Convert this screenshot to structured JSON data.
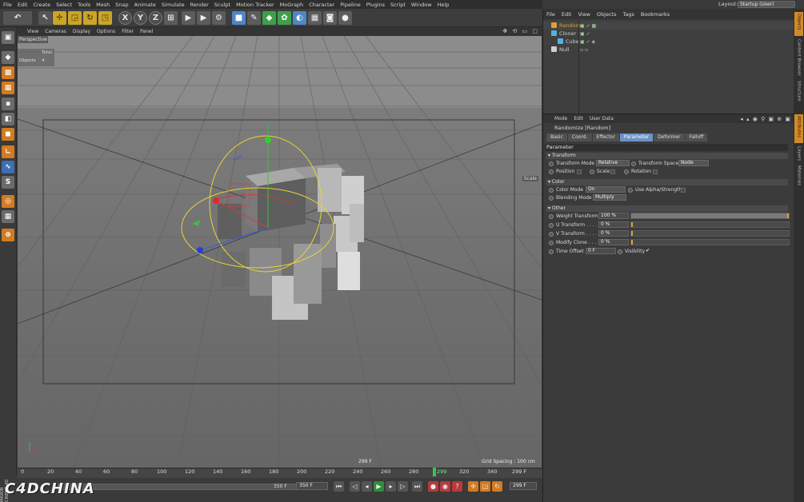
{
  "menubar": {
    "items": [
      "File",
      "Edit",
      "Create",
      "Select",
      "Tools",
      "Mesh",
      "Snap",
      "Animate",
      "Simulate",
      "Render",
      "Sculpt",
      "Motion Tracker",
      "MoGraph",
      "Character",
      "Pipeline",
      "Plugins",
      "Script",
      "Window",
      "Help"
    ],
    "layout_label": "Layout:",
    "layout_value": "Startup (User)"
  },
  "toolbar": {
    "undo": "↶",
    "axis_x": "X",
    "axis_y": "Y",
    "axis_z": "Z"
  },
  "viewport": {
    "menu": [
      "View",
      "Cameras",
      "Display",
      "Options",
      "Filter",
      "Panel"
    ],
    "label": "Perspective",
    "stats_total": "Total",
    "stats_objects_label": "Objects",
    "stats_objects_value": "4",
    "scale_label": "Scale",
    "frame_readout": "299 F",
    "grid_spacing": "Grid Spacing : 100 cm",
    "icons": "✥ ⟲ ▭ ▢"
  },
  "timeline": {
    "ticks": [
      "0",
      "20",
      "40",
      "60",
      "80",
      "100",
      "120",
      "140",
      "160",
      "180",
      "200",
      "220",
      "240",
      "260",
      "280",
      "299",
      "320",
      "340"
    ],
    "current_frame": "299",
    "end_label": "299 F",
    "range_end_a": "350 F",
    "range_end_b": "350 F",
    "frame_field": "299 F"
  },
  "brand": {
    "text": "C4DCHINA",
    "maxon": "MAXON CINEMA 4D"
  },
  "object_manager": {
    "menu": [
      "File",
      "Edit",
      "View",
      "Objects",
      "Tags",
      "Bookmarks"
    ],
    "objects": [
      {
        "name": "Random",
        "color": "#e0a032",
        "indent": 0
      },
      {
        "name": "Cloner",
        "color": "#56b1e0",
        "indent": 0
      },
      {
        "name": "Cube",
        "color": "#56b1e0",
        "indent": 1
      },
      {
        "name": "Null",
        "color": "#cfcfcf",
        "indent": 0
      }
    ]
  },
  "attribute_manager": {
    "menu": [
      "Mode",
      "Edit",
      "User Data"
    ],
    "title": "Randomize [Random]",
    "tabs": [
      "Basic",
      "Coord.",
      "Effector",
      "Parameter",
      "Deformer",
      "Falloff"
    ],
    "active_tab": "Parameter",
    "section_parameter": "Parameter",
    "sub_transform": "Transform",
    "transform_mode_label": "Transform Mode",
    "transform_mode_value": "Relative",
    "transform_space_label": "Transform Space",
    "transform_space_value": "Node",
    "position_label": "Position",
    "scale_label": "Scale",
    "rotation_label": "Rotation",
    "sub_color": "Color",
    "color_mode_label": "Color Mode",
    "color_mode_value": "On",
    "use_alpha_label": "Use Alpha/Strength",
    "blending_mode_label": "Blending Mode",
    "blending_mode_value": "Multiply",
    "sub_other": "Other",
    "weight_transform_label": "Weight Transform",
    "weight_transform_value": "100 %",
    "weight_transform_fraction": 1.0,
    "u_transform_label": "U Transform . . . .",
    "u_transform_value": "0 %",
    "v_transform_label": "V Transform . . . .",
    "v_transform_value": "0 %",
    "modify_clone_label": "Modify Clone . . . .",
    "modify_clone_value": "0 %",
    "time_offset_label": "Time Offset",
    "time_offset_value": "0 F",
    "visibility_label": "Visibility",
    "visibility_check": "✔",
    "icons": "◂ ▴ ◉ ⚲ ▣ ⊕ ▣"
  },
  "right_tabs": [
    "Objects",
    "Content Browser",
    "Structure",
    "Attributes",
    "Layers",
    "Materials"
  ]
}
